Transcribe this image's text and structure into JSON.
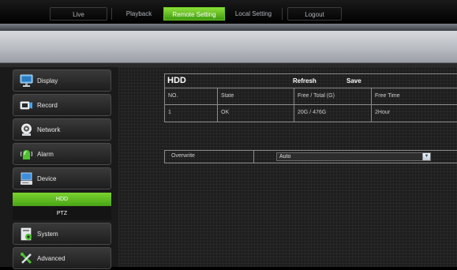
{
  "nav": {
    "tabs": [
      {
        "label": "Live"
      },
      {
        "label": "Playback"
      },
      {
        "label": "Remote Setting"
      },
      {
        "label": "Local Setting"
      },
      {
        "label": "Logout"
      }
    ],
    "active": "Remote Setting",
    "accent_color": "#5bb81e"
  },
  "sidebar": {
    "items": [
      {
        "label": "Display",
        "icon": "monitor-icon"
      },
      {
        "label": "Record",
        "icon": "camera-icon"
      },
      {
        "label": "Network",
        "icon": "network-icon"
      },
      {
        "label": "Alarm",
        "icon": "alarm-icon"
      },
      {
        "label": "Device",
        "icon": "device-icon"
      },
      {
        "label": "System",
        "icon": "system-icon"
      },
      {
        "label": "Advanced",
        "icon": "tools-icon"
      }
    ],
    "device_subitems": [
      {
        "label": "HDD",
        "active": true
      },
      {
        "label": "PTZ",
        "active": false
      }
    ]
  },
  "hdd_panel": {
    "title": "HDD",
    "refresh_label": "Refresh",
    "save_label": "Save",
    "columns": [
      "NO.",
      "State",
      "Free / Total (G)",
      "Free Time"
    ],
    "rows": [
      {
        "no": "1",
        "state": "OK",
        "free_total": "20G / 476G",
        "free_time": "2Hour"
      }
    ]
  },
  "overwrite": {
    "label": "Overwrite",
    "value": "Auto"
  }
}
